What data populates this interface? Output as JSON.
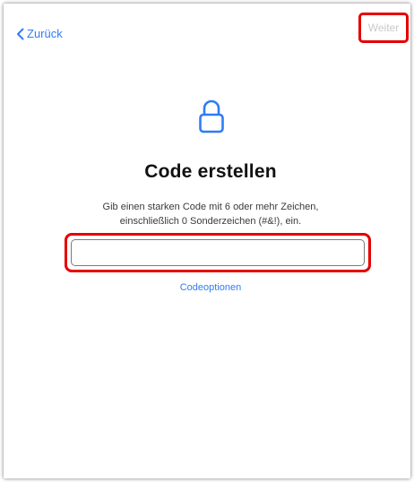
{
  "nav": {
    "back_label": "Zurück",
    "next_label": "Weiter"
  },
  "content": {
    "icon": "lock-icon",
    "title": "Code erstellen",
    "subtitle_line1": "Gib einen starken Code mit 6 oder mehr Zeichen,",
    "subtitle_line2": "einschließlich 0 Sonderzeichen (#&!), ein.",
    "code_input_value": "",
    "code_options_label": "Codeoptionen"
  },
  "colors": {
    "accent": "#2f7cf6",
    "disabled_text": "#c9c9cc",
    "highlight": "#e50000"
  }
}
